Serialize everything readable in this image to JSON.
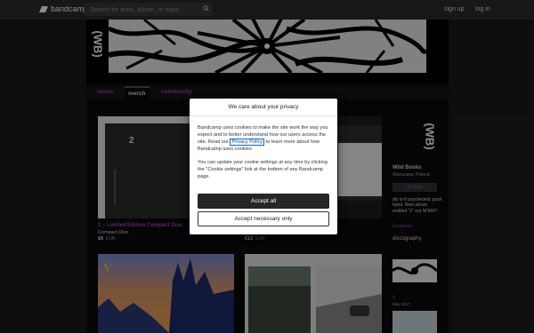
{
  "topbar": {
    "logo_text": "bandcamp",
    "search_placeholder": "Search for artist, album, or track",
    "signup": "sign up",
    "login": "log in"
  },
  "banner": {
    "logo": "(WB)"
  },
  "tabs": [
    "music",
    "merch",
    "community"
  ],
  "items": [
    {
      "title": "2 – Limited Edition Compact Disc",
      "format": "Compact Disc",
      "price": "€8",
      "currency": "EUR",
      "art_text": "2"
    },
    {
      "price": "€12",
      "currency": "EUR"
    }
  ],
  "sidebar": {
    "logo": "(WB)",
    "band_name": "Wild Books",
    "location": "Warszawa, Poland",
    "follow": "Follow",
    "bio": "diy lo-fi psychedelic punk band. New album entitled \"2\" out NOW!!!",
    "facebook": "Facebook",
    "discography": "discography",
    "disc_title": "2",
    "disc_date": "May 2017"
  },
  "cookie": {
    "title": "We care about your privacy",
    "body1_pre": "Bandcamp uses cookies to make the site work the way you expect and to better understand how our users access the site. Read our ",
    "privacy_link": "Privacy Policy",
    "body1_post": " to learn more about how Bandcamp uses cookies.",
    "body2": "You can update your cookie settings at any time by clicking the \"Cookie settings\" link at the bottom of any Bandcamp page.",
    "accept_all": "Accept all",
    "accept_necessary": "Accept necessary only"
  },
  "colors": {
    "accent": "#a83ec4",
    "topbar": "#2b2b2b",
    "page": "#0a0a0a"
  }
}
